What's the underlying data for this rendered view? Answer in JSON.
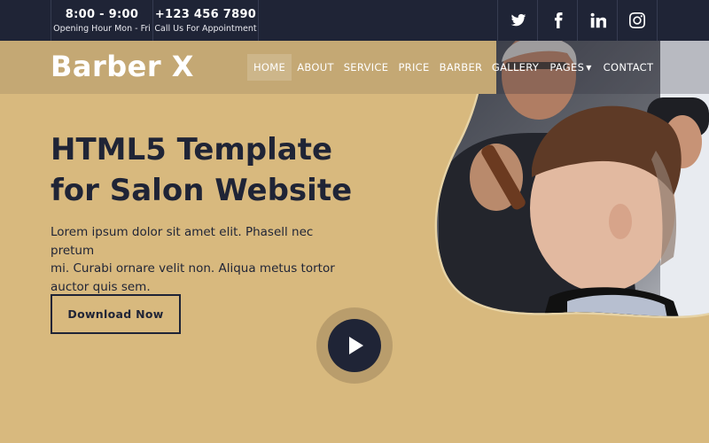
{
  "topbar": {
    "hours": {
      "main": "8:00 - 9:00",
      "sub": "Opening Hour Mon - Fri"
    },
    "phone": {
      "main": "+123 456 7890",
      "sub": "Call Us For Appointment"
    },
    "social": [
      {
        "icon": "twitter-icon"
      },
      {
        "icon": "facebook-icon"
      },
      {
        "icon": "linkedin-icon"
      },
      {
        "icon": "instagram-icon"
      }
    ]
  },
  "brand": {
    "name": "Barber",
    "mark": "X"
  },
  "nav": {
    "items": [
      {
        "label": "HOME",
        "active": true
      },
      {
        "label": "ABOUT"
      },
      {
        "label": "SERVICE"
      },
      {
        "label": "PRICE"
      },
      {
        "label": "BARBER"
      },
      {
        "label": "GALLERY"
      },
      {
        "label": "PAGES",
        "has_dropdown": true
      },
      {
        "label": "CONTACT"
      }
    ]
  },
  "hero": {
    "title_line1": "HTML5 Template",
    "title_line2": "for Salon Website",
    "text_line1": "Lorem ipsum dolor sit amet elit. Phasell nec pretum",
    "text_line2": "mi. Curabi ornare velit non. Aliqua metus tortor",
    "text_line3": "auctor quis sem.",
    "button_label": "Download Now",
    "play_icon": "play-icon"
  },
  "colors": {
    "dark_navy": "#1f2436",
    "gold": "#d8b97e",
    "white": "#ffffff"
  }
}
